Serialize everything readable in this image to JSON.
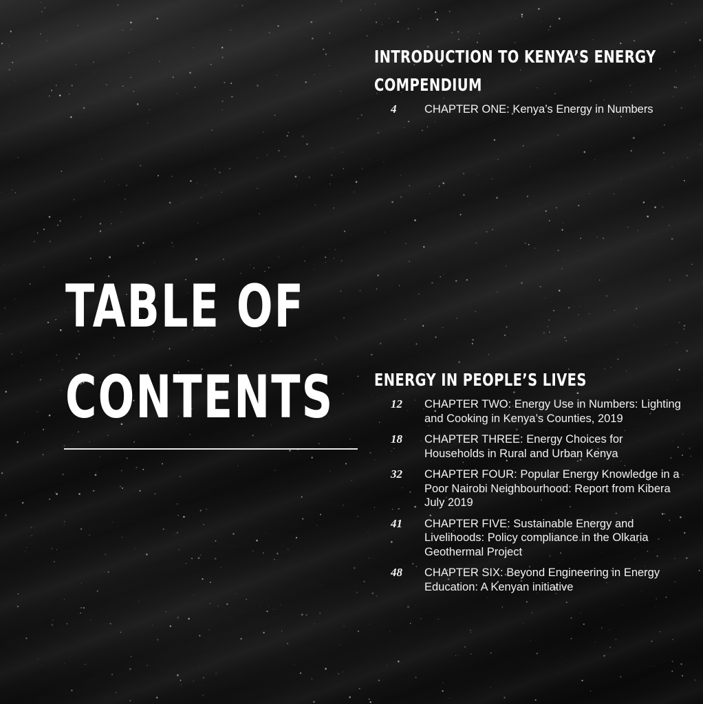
{
  "page": {
    "title_line1": "TABLE OF",
    "title_line2": "CONTENTS"
  },
  "sections": [
    {
      "heading_line1": "INTRODUCTION TO KENYA’S ENERGY",
      "heading_line2": "COMPENDIUM",
      "entries": [
        {
          "page": "4",
          "text": "CHAPTER ONE: Kenya’s Energy in Numbers"
        }
      ]
    },
    {
      "heading_line1": "ENERGY IN PEOPLE’S LIVES",
      "entries": [
        {
          "page": "12",
          "text": "CHAPTER TWO: Energy Use in Numbers: Lighting and Cooking in Kenya’s Counties, 2019"
        },
        {
          "page": "18",
          "text": "CHAPTER THREE: Energy Choices for Households in Rural and Urban Kenya"
        },
        {
          "page": "32",
          "text": "CHAPTER FOUR: Popular Energy Knowledge in a Poor Nairobi Neighbourhood: Report from Kibera July 2019"
        },
        {
          "page": "41",
          "text": "CHAPTER FIVE: Sustainable Energy and Livelihoods: Policy compliance in the Olkaria Geothermal Project"
        },
        {
          "page": "48",
          "text": "CHAPTER SIX: Beyond Engineering in Energy Education: A Kenyan initiative"
        }
      ]
    }
  ],
  "colors": {
    "text": "#ffffff",
    "background": "#141414",
    "rule": "#e8e8e8"
  }
}
